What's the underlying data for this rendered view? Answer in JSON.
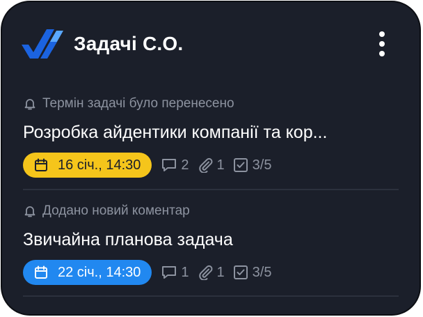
{
  "widget": {
    "title": "Задачі С.О.",
    "logo": "app-logo",
    "menu_icon": "more-vertical-icon"
  },
  "colors": {
    "background": "#1b1f2a",
    "muted_text": "#8d93a0",
    "badge_yellow": "#f5c51b",
    "badge_blue": "#2188f0",
    "logo_dark": "#1b63e0",
    "logo_light": "#5aa8ff"
  },
  "notifications": [
    {
      "notice": "Термін задачі було перенесено",
      "notice_icon": "bell-icon",
      "task_title": "Розробка айдентики компанії та кор...",
      "due_date": "16 січ., 14:30",
      "badge_color": "yellow",
      "comments": "2",
      "attachments": "1",
      "checklist": "3/5"
    },
    {
      "notice": "Додано новий коментар",
      "notice_icon": "bell-icon",
      "task_title": "Звичайна планова задача",
      "due_date": "22 січ., 14:30",
      "badge_color": "blue",
      "comments": "1",
      "attachments": "1",
      "checklist": "3/5"
    }
  ]
}
